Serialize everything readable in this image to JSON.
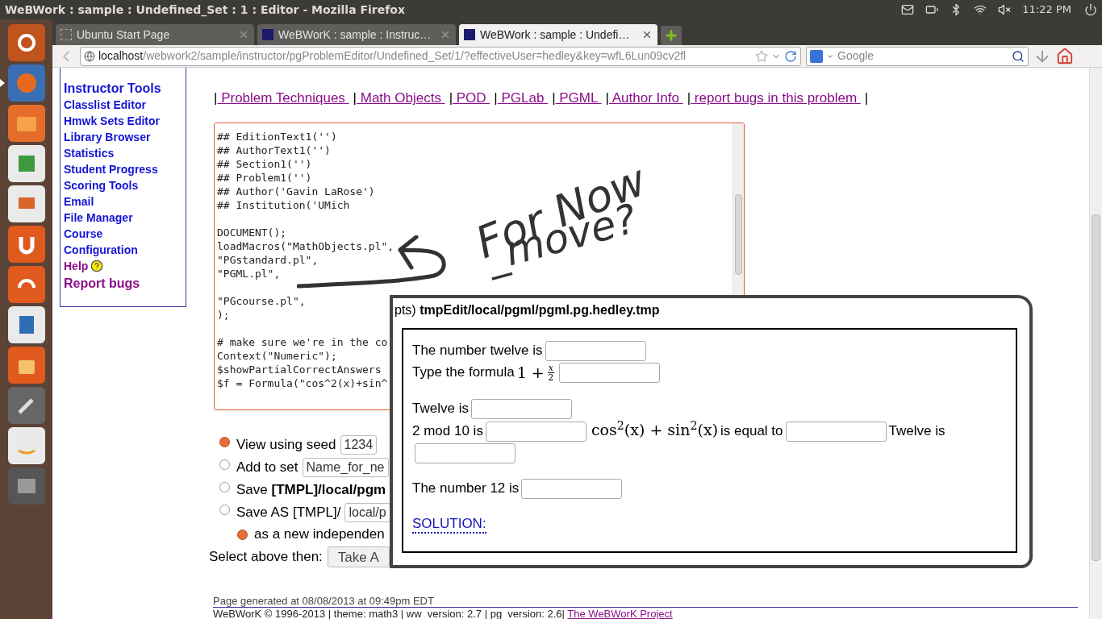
{
  "window": {
    "title": "WeBWork : sample : Undefined_Set : 1 : Editor - Mozilla Firefox"
  },
  "panel": {
    "indicators": [
      {
        "kind": "mail"
      },
      {
        "kind": "battery"
      },
      {
        "kind": "bluetooth"
      },
      {
        "kind": "wifi"
      },
      {
        "kind": "muted"
      }
    ],
    "time": "11:22 PM"
  },
  "launcher": [
    {
      "kind": "ubuntu",
      "running": false
    },
    {
      "kind": "firefox",
      "running": true
    },
    {
      "kind": "folder",
      "running": false
    },
    {
      "kind": "spreadsheet",
      "running": false
    },
    {
      "kind": "presentation",
      "running": false
    },
    {
      "kind": "u",
      "running": false
    },
    {
      "kind": "headphones",
      "running": false
    },
    {
      "kind": "document",
      "running": false
    },
    {
      "kind": "bag",
      "running": false
    },
    {
      "kind": "tools",
      "running": false
    },
    {
      "kind": "amazon",
      "running": false
    },
    {
      "kind": "workspaces",
      "running": false
    }
  ],
  "tabs": [
    {
      "label": "Ubuntu Start Page",
      "selected": false,
      "kind": "blank"
    },
    {
      "label": "WeBWorK : sample : Instruc…",
      "selected": false,
      "kind": "webwork"
    },
    {
      "label": "WeBWork : sample : Undefi…",
      "selected": true,
      "kind": "webwork"
    }
  ],
  "address": {
    "host": "localhost",
    "path": "/webwork2/sample/instructor/pgProblemEditor/Undefined_Set/1/?effectiveUser=hedley&key=wfL6Lun09cv2fl"
  },
  "search": {
    "placeholder": "Google"
  },
  "sidebar": {
    "items": [
      {
        "label": "Instructor Tools",
        "kind": "heading"
      },
      {
        "label": "Classlist Editor",
        "kind": "link"
      },
      {
        "label": "Hmwk Sets Editor",
        "kind": "link"
      },
      {
        "label": "Library Browser",
        "kind": "link"
      },
      {
        "label": "Statistics",
        "kind": "link"
      },
      {
        "label": "Student Progress",
        "kind": "link"
      },
      {
        "label": "Scoring Tools",
        "kind": "link"
      },
      {
        "label": "Email",
        "kind": "link"
      },
      {
        "label": "File Manager",
        "kind": "link"
      },
      {
        "label": "Course",
        "kind": "link"
      },
      {
        "label": "Configuration",
        "kind": "link"
      },
      {
        "label": "Help",
        "kind": "help"
      },
      {
        "label": "Report bugs",
        "kind": "visited"
      }
    ]
  },
  "links": {
    "separator": "|",
    "items": [
      " Problem Techniques ",
      " Math Objects ",
      " POD ",
      " PGLab ",
      " PGML ",
      " Author Info ",
      " report bugs in this problem "
    ],
    "end": "|"
  },
  "editor": {
    "blocks": [
      [
        "## EditionText1('')",
        "## AuthorText1('')",
        "## Section1('')",
        "## Problem1('')",
        "## Author('Gavin LaRose')",
        "## Institution('UMich"
      ],
      [
        "DOCUMENT();",
        "loadMacros(\"MathObjects.pl\",",
        "\"PGstandard.pl\",",
        "\"PGML.pl\","
      ],
      [
        "\"PGcourse.pl\",",
        ");"
      ],
      [
        "# make sure we're in the co",
        "Context(\"Numeric\");",
        "$showPartialCorrectAnswers",
        "$f = Formula(\"cos^2(x)+sin^"
      ]
    ]
  },
  "options": [
    {
      "kind": "radio",
      "selected": true,
      "label": "View using seed",
      "field": "1234"
    },
    {
      "kind": "radio",
      "selected": false,
      "label": "Add to set",
      "field": "Name_for_ne"
    },
    {
      "kind": "radio",
      "selected": false,
      "label": "Save **[TMPL]/local/pgm**"
    },
    {
      "kind": "radio",
      "selected": false,
      "label": "Save AS [TMPL]/",
      "field": "local/p"
    },
    {
      "kind": "subradio",
      "selected": true,
      "label": "as a new independen"
    },
    {
      "kind": "action",
      "label": "Select above then:",
      "button": "Take A"
    }
  ],
  "note": {
    "lines": [
      "For Now",
      "_move?"
    ]
  },
  "problem": {
    "title": "pts) **tmpEdit/local/pgml/pgml.pg.hedley.tmp**",
    "paragraphs": [
      [
        {
          "kind": "text",
          "text": "The number twelve is"
        },
        {
          "kind": "input"
        },
        {
          "kind": "break"
        },
        {
          "kind": "text",
          "text": "Type the formula"
        },
        {
          "kind": "fraction",
          "lead": "1 +",
          "num": "x",
          "den": "2"
        },
        {
          "kind": "input"
        }
      ],
      [
        {
          "kind": "text",
          "text": "Twelve is"
        },
        {
          "kind": "input"
        },
        {
          "kind": "break"
        },
        {
          "kind": "text",
          "text": "2 mod 10 is"
        },
        {
          "kind": "input"
        },
        {
          "kind": "math",
          "text": "cos$^{2}$(x) + sin$^{2}$(x)"
        },
        {
          "kind": "text",
          "text": "is equal to"
        },
        {
          "kind": "input"
        },
        {
          "kind": "text",
          "text": "Twelve is"
        },
        {
          "kind": "input"
        }
      ],
      [
        {
          "kind": "text",
          "text": "The number 12 is"
        },
        {
          "kind": "input"
        }
      ]
    ],
    "solution": "SOLUTION:"
  },
  "footer": {
    "generated": "Page generated at 08/08/2013 at 09:49pm EDT",
    "copyright": "WeBWorK © 1996-2013 | theme: math3 | ww_version: 2.7 | pg_version: 2.6|",
    "link": "The WeBWorK Project"
  }
}
